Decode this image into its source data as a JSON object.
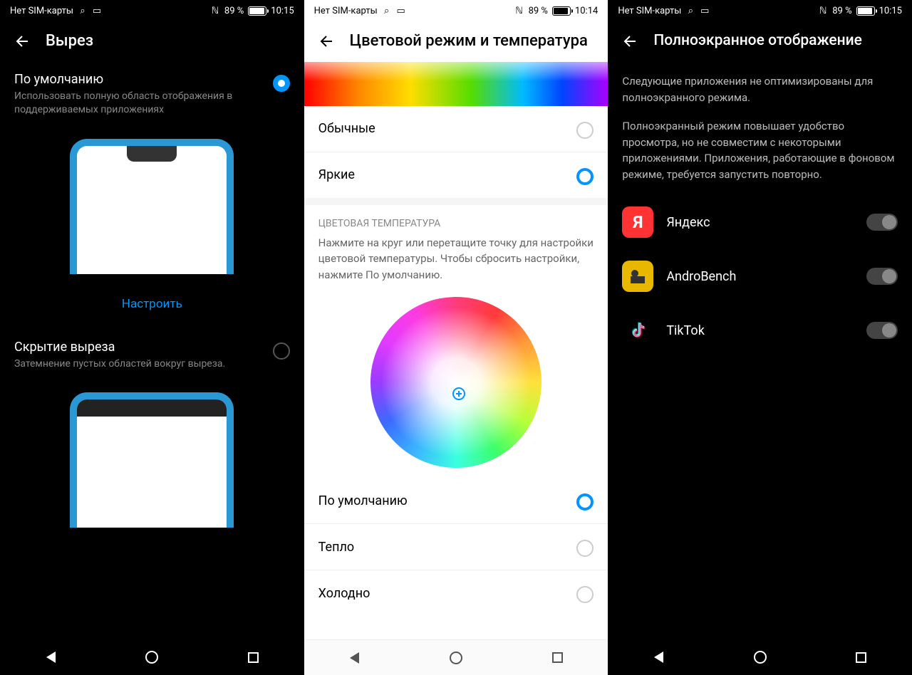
{
  "statusbars": {
    "sim": "Нет SIM-карты",
    "battery_a": "89 %",
    "battery_b": "89 %",
    "battery_c": "89 %",
    "time_a": "10:15",
    "time_b": "10:14",
    "time_c": "10:15"
  },
  "screen1": {
    "title": "Вырез",
    "option1_title": "По умолчанию",
    "option1_desc": "Использовать полную область отображения в поддерживаемых приложениях",
    "customize": "Настроить",
    "option2_title": "Скрытие выреза",
    "option2_desc": "Затемнение пустых областей вокруг выреза."
  },
  "screen2": {
    "title": "Цветовой режим и температура",
    "mode_normal": "Обычные",
    "mode_vivid": "Яркие",
    "section_title": "ЦВЕТОВАЯ ТЕМПЕРАТУРА",
    "section_desc": "Нажмите на круг или перетащите точку для настройки цветовой температуры. Чтобы сбросить настройки, нажмите По умолчанию.",
    "preset_default": "По умолчанию",
    "preset_warm": "Тепло",
    "preset_cold": "Холодно"
  },
  "screen3": {
    "title": "Полноэкранное отображение",
    "info1": "Следующие приложения не оптимизированы для полноэкранного режима.",
    "info2": "Полноэкранный режим повышает удобство просмотра, но не совместим с некоторыми приложениями. Приложения, работающие в фоновом режиме, требуется запустить повторно.",
    "apps": [
      {
        "name": "Яндекс",
        "icon_letter": "Я",
        "icon_bg": "#ff3333",
        "icon_fg": "#fff"
      },
      {
        "name": "AndroBench",
        "icon_letter": "",
        "icon_bg": "#e8b800",
        "icon_fg": "#000"
      },
      {
        "name": "TikTok",
        "icon_letter": "",
        "icon_bg": "#000",
        "icon_fg": "#fff"
      }
    ]
  }
}
